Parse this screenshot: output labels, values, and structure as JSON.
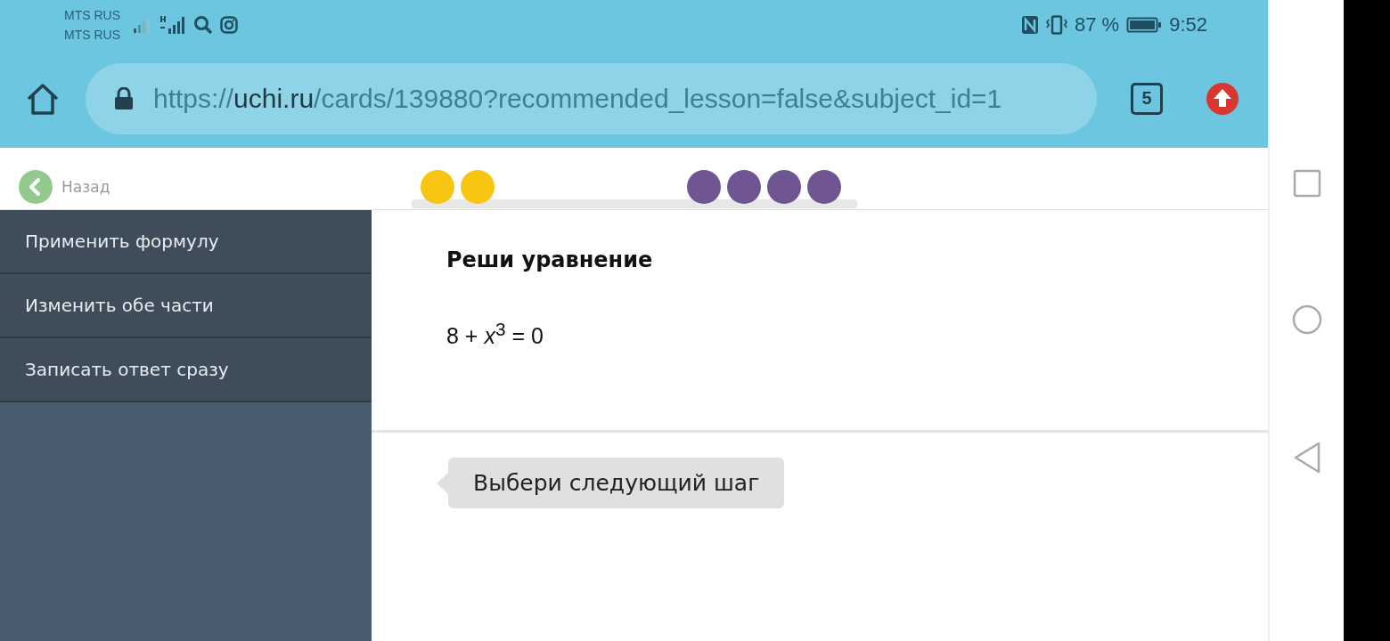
{
  "status_bar": {
    "carriers": [
      "MTS RUS",
      "MTS RUS"
    ],
    "battery_percent": "87 %",
    "time": "9:52"
  },
  "browser": {
    "url_scheme": "https://",
    "url_host": "uchi.ru",
    "url_path": "/cards/139880?recommended_lesson=false&subject_id=1",
    "tab_count": "5"
  },
  "header": {
    "back_label": "Назад",
    "progress_dots": [
      {
        "color": "#f9c513"
      },
      {
        "color": "#f9c513"
      },
      {
        "color": "#6f5592"
      },
      {
        "color": "#6f5592"
      },
      {
        "color": "#6f5592"
      },
      {
        "color": "#6f5592"
      }
    ]
  },
  "sidebar": {
    "items": [
      {
        "label": "Применить формулу"
      },
      {
        "label": "Изменить обе части"
      },
      {
        "label": "Записать ответ сразу"
      }
    ]
  },
  "task": {
    "title": "Реши уравнение",
    "equation": "8 + *x*$^{3}$ = 0"
  },
  "hint": "Выбери следующий шаг"
}
